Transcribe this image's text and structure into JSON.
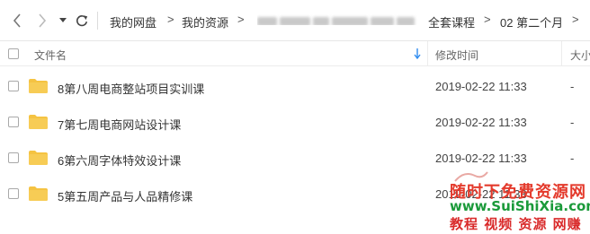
{
  "navigation": {
    "back_icon": "chevron-left-icon",
    "forward_icon": "chevron-right-icon",
    "dropdown_icon": "caret-down-icon",
    "refresh_icon": "refresh-icon",
    "breadcrumbs": [
      "我的网盘",
      "我的资源",
      "全套课程",
      "02 第二个月"
    ]
  },
  "table": {
    "headers": {
      "name": "文件名",
      "modified": "修改时间",
      "size": "大小"
    },
    "sort_icon": "sort-down-arrow-icon",
    "rows": [
      {
        "name": "8第八周电商整站项目实训课",
        "modified": "2019-02-22 11:33",
        "size": "-"
      },
      {
        "name": "7第七周电商网站设计课",
        "modified": "2019-02-22 11:33",
        "size": "-"
      },
      {
        "name": "6第六周字体特效设计课",
        "modified": "2019-02-22 11:33",
        "size": "-"
      },
      {
        "name": "5第五周产品与人品精修课",
        "modified": "2019-02-22 11:33",
        "size": "-"
      }
    ]
  },
  "watermark": {
    "line1": "随时下免费资源网",
    "line2": "www.SuiShiXia.com",
    "line3": "教程 视频 资源 网赚"
  },
  "colors": {
    "folder": "#f5c342",
    "link_blue": "#2f8cf0",
    "watermark_red": "#e43a2c",
    "watermark_green": "#1b9a3a"
  }
}
